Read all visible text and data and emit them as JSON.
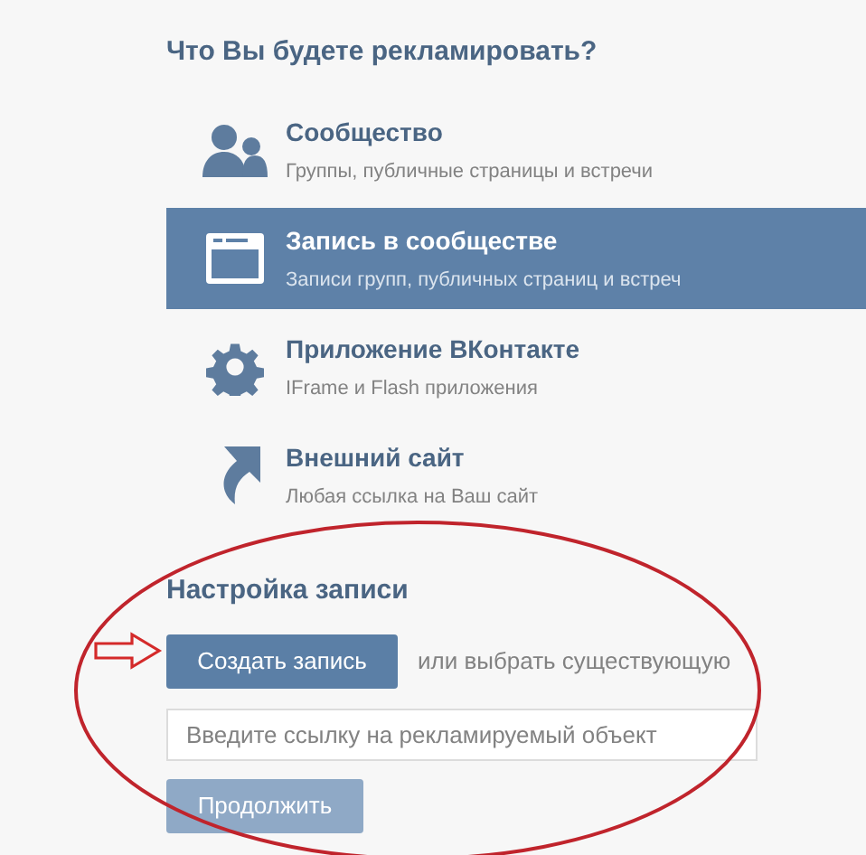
{
  "heading": "Что Вы будете рекламировать?",
  "options": [
    {
      "kind": "community",
      "title": "Сообщество",
      "subtitle": "Группы, публичные страницы и встречи",
      "selected": false
    },
    {
      "kind": "post",
      "title": "Запись в сообществе",
      "subtitle": "Записи групп, публичных страниц и встреч",
      "selected": true
    },
    {
      "kind": "app",
      "title": "Приложение ВКонтакте",
      "subtitle": "IFrame и Flash приложения",
      "selected": false
    },
    {
      "kind": "site",
      "title": "Внешний сайт",
      "subtitle": "Любая ссылка на Ваш сайт",
      "selected": false
    }
  ],
  "settings": {
    "heading": "Настройка записи",
    "create_button": "Создать запись",
    "alternative": "или выбрать существующую",
    "link_field": {
      "placeholder": "Введите ссылку на рекламируемый объект"
    },
    "continue_button": {
      "label": "Продолжить",
      "disabled": true
    }
  },
  "annotations": {
    "circled_section": true,
    "pointer_arrow": true
  }
}
